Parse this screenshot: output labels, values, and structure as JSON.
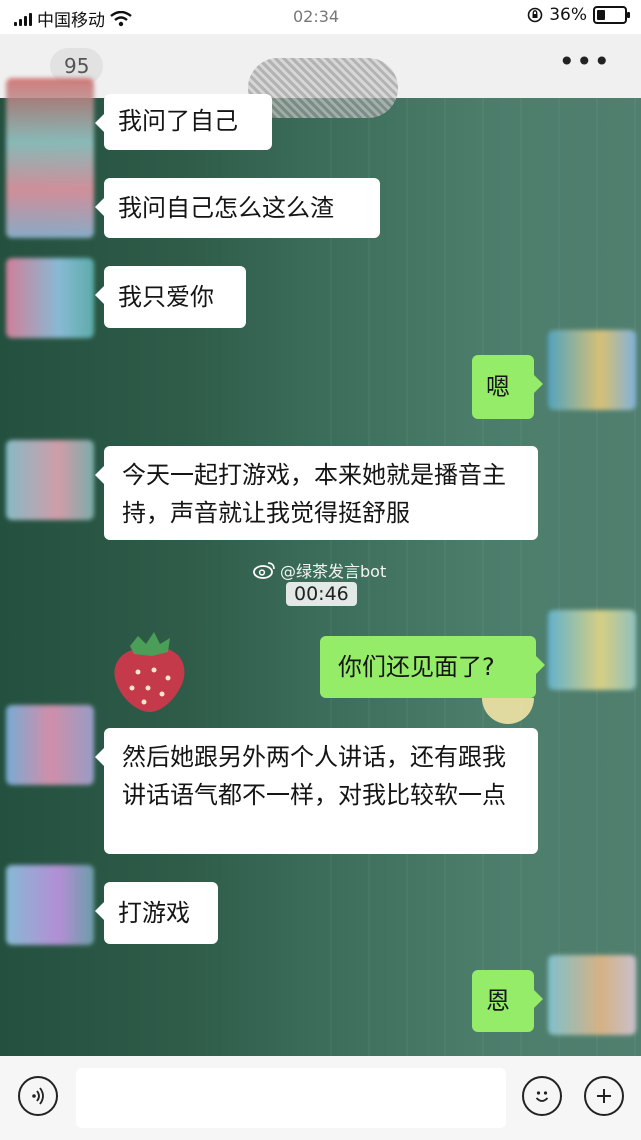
{
  "status_bar": {
    "carrier": "中国移动",
    "time": "02:34",
    "battery": "36%",
    "battery_level": 0.36
  },
  "header": {
    "back_count": "95",
    "more_label": "•••"
  },
  "messages": [
    {
      "side": "left",
      "text": "我问了自己"
    },
    {
      "side": "left",
      "text": "我问自己怎么这么渣"
    },
    {
      "side": "left",
      "text": "我只爱你"
    },
    {
      "side": "right",
      "text": "嗯"
    },
    {
      "side": "left",
      "text": "今天一起打游戏，本来她就是播音主持，声音就让我觉得挺舒服"
    },
    {
      "side": "right",
      "text": "你们还见面了?"
    },
    {
      "side": "left",
      "text": "然后她跟另外两个人讲话，还有跟我讲话语气都不一样，对我比较软一点"
    },
    {
      "side": "left",
      "text": "打游戏"
    },
    {
      "side": "right",
      "text": "恩"
    }
  ],
  "watermark": "@绿茶发言bot",
  "video_time": "00:46",
  "icons": {
    "signal": "signal-bars-icon",
    "wifi": "wifi-icon",
    "lock": "orientation-lock-icon",
    "battery": "battery-icon",
    "weibo": "weibo-icon",
    "voice": "voice-icon",
    "emoji": "emoji-icon",
    "add": "plus-icon"
  },
  "colors": {
    "outgoing_bubble": "#95ec69",
    "incoming_bubble": "#ffffff"
  }
}
